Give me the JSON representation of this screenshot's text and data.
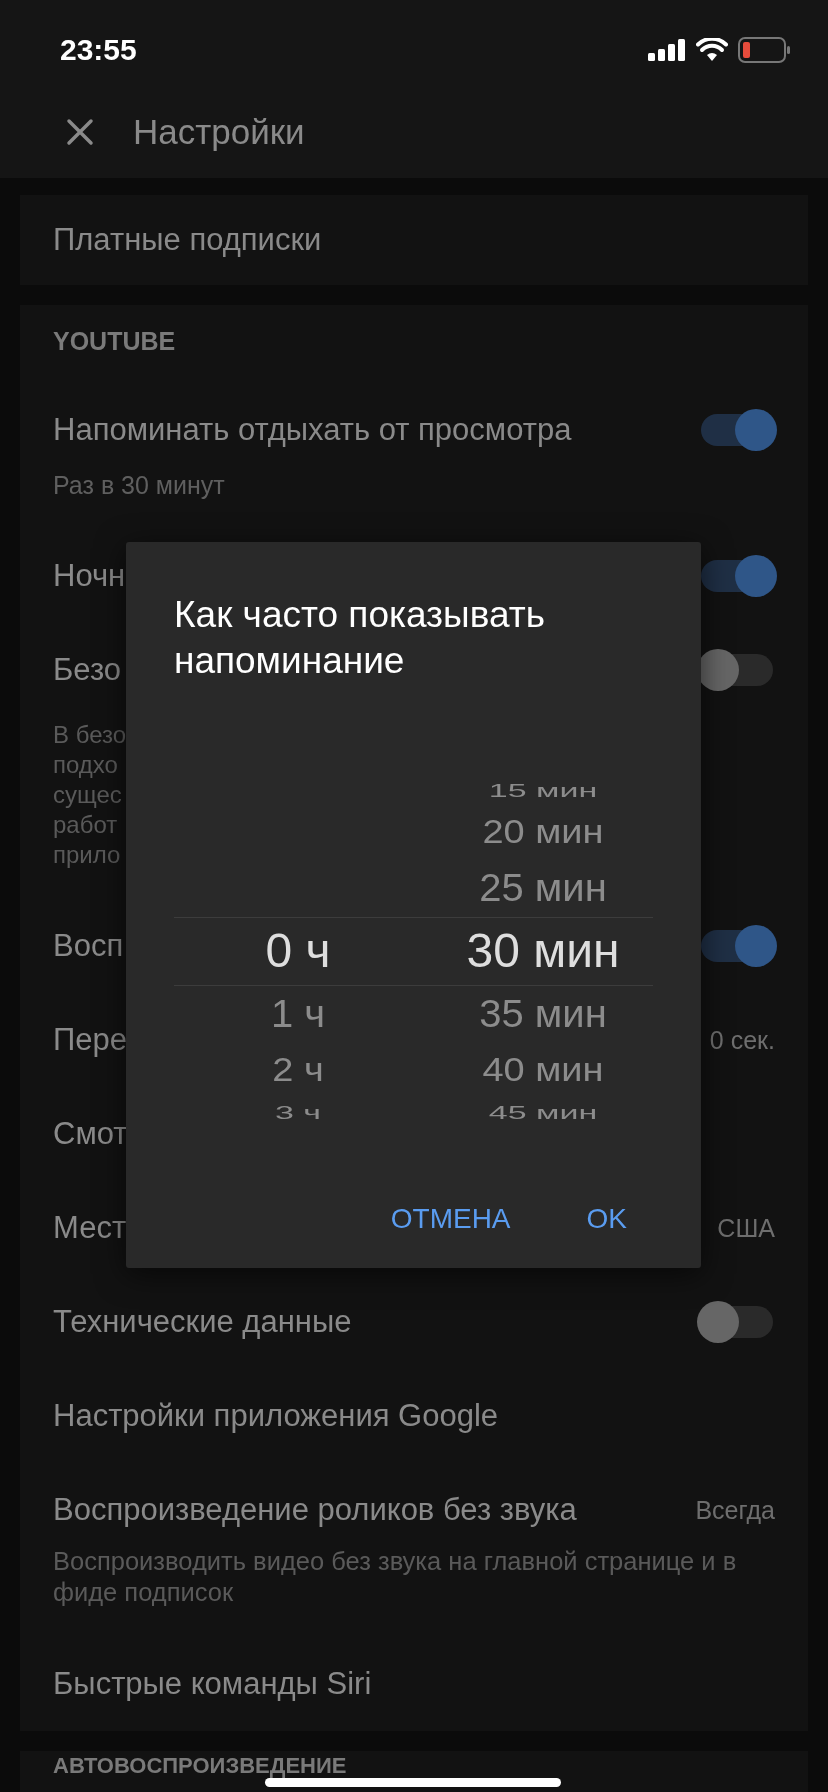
{
  "status_bar": {
    "time": "23:55"
  },
  "header": {
    "title": "Настройки"
  },
  "sections": [
    {
      "items": [
        {
          "kind": "plain",
          "title": "Платные подписки"
        }
      ]
    },
    {
      "heading": "YOUTUBE",
      "items": [
        {
          "kind": "toggle",
          "title": "Напоминать отдыхать от просмотра",
          "subtitle": "Раз в 30 минут",
          "on": true
        },
        {
          "kind": "toggle",
          "title": "Ночн",
          "on": true
        },
        {
          "kind": "toggle",
          "title": "Безо",
          "on": false,
          "description_lines": [
            "В безо",
            "подхо",
            "сущес",
            "работ",
            "прило"
          ]
        },
        {
          "kind": "toggle",
          "title": "Восп",
          "on": true
        },
        {
          "kind": "value",
          "title": "Пере",
          "value": "0 сек."
        },
        {
          "kind": "plain",
          "title": "Смот"
        },
        {
          "kind": "value",
          "title": "Мест",
          "value": "США"
        },
        {
          "kind": "toggle",
          "title": "Технические данные",
          "on": false
        },
        {
          "kind": "plain",
          "title": "Настройки приложения Google"
        },
        {
          "kind": "value",
          "title": "Воспроизведение роликов без звука",
          "value": "Всегда",
          "description": "Воспроизводить видео без звука на главной странице и в фиде подписок"
        },
        {
          "kind": "plain",
          "title": "Быстрые команды Siri"
        }
      ]
    },
    {
      "heading": "АВТОВОСПРОИЗВЕДЕНИЕ"
    }
  ],
  "dialog": {
    "title": "Как часто показывать напоминание",
    "columns": [
      {
        "items": [
          {
            "label": "0 ч",
            "selected": true
          },
          {
            "label": "1 ч",
            "selected": false
          },
          {
            "label": "2 ч",
            "selected": false
          },
          {
            "label": "3 ч",
            "selected": false
          }
        ]
      },
      {
        "items": [
          {
            "label": "15 мин",
            "selected": false
          },
          {
            "label": "20 мин",
            "selected": false
          },
          {
            "label": "25 мин",
            "selected": false
          },
          {
            "label": "30 мин",
            "selected": true
          },
          {
            "label": "35 мин",
            "selected": false
          },
          {
            "label": "40 мин",
            "selected": false
          },
          {
            "label": "45 мин",
            "selected": false
          }
        ]
      }
    ],
    "buttons": [
      "ОТМЕНА",
      "OK"
    ]
  }
}
